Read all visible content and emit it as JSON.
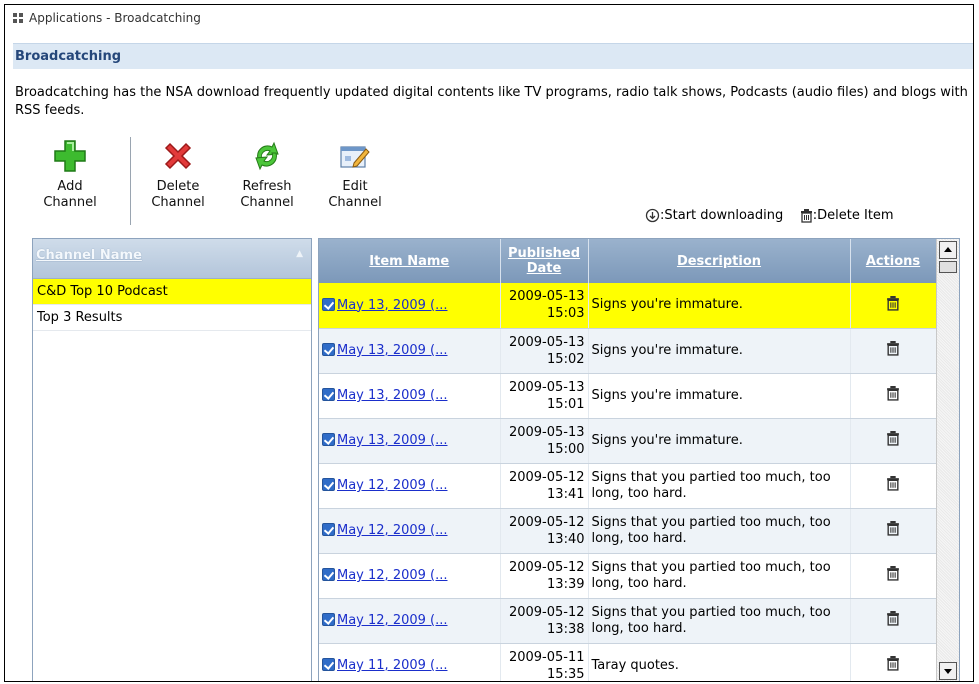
{
  "breadcrumb": {
    "text": "Applications - Broadcatching"
  },
  "section": {
    "title": "Broadcatching"
  },
  "intro": {
    "text": "Broadcatching has the NSA download frequently updated digital contents like TV programs, radio talk shows, Podcasts (audio files) and blogs with RSS feeds."
  },
  "toolbar": {
    "add_line1": "Add",
    "add_line2": "Channel",
    "delete_line1": "Delete",
    "delete_line2": "Channel",
    "refresh_line1": "Refresh",
    "refresh_line2": "Channel",
    "edit_line1": "Edit",
    "edit_line2": "Channel"
  },
  "legend": {
    "start_downloading": ":Start downloading",
    "delete_item": ":Delete Item"
  },
  "channels": {
    "header": "Channel Name",
    "items": [
      {
        "name": "C&D Top 10 Podcast",
        "selected": true
      },
      {
        "name": "Top 3 Results",
        "selected": false
      }
    ]
  },
  "items_table": {
    "headers": {
      "item_name": "Item Name",
      "published_line1": "Published",
      "published_line2": "Date",
      "description": "Description",
      "actions": "Actions"
    },
    "rows": [
      {
        "name": "May 13, 2009 (...",
        "date": "2009-05-13",
        "time": "15:03",
        "desc": "Signs you're immature."
      },
      {
        "name": "May 13, 2009 (...",
        "date": "2009-05-13",
        "time": "15:02",
        "desc": "Signs you're immature."
      },
      {
        "name": "May 13, 2009 (...",
        "date": "2009-05-13",
        "time": "15:01",
        "desc": "Signs you're immature."
      },
      {
        "name": "May 13, 2009 (...",
        "date": "2009-05-13",
        "time": "15:00",
        "desc": "Signs you're immature."
      },
      {
        "name": "May 12, 2009 (...",
        "date": "2009-05-12",
        "time": "13:41",
        "desc": "Signs that you partied too much, too long, too hard."
      },
      {
        "name": "May 12, 2009 (...",
        "date": "2009-05-12",
        "time": "13:40",
        "desc": "Signs that you partied too much, too long, too hard."
      },
      {
        "name": "May 12, 2009 (...",
        "date": "2009-05-12",
        "time": "13:39",
        "desc": "Signs that you partied too much, too long, too hard."
      },
      {
        "name": "May 12, 2009 (...",
        "date": "2009-05-12",
        "time": "13:38",
        "desc": "Signs that you partied too much, too long, too hard."
      },
      {
        "name": "May 11, 2009 (...",
        "date": "2009-05-11",
        "time": "15:35",
        "desc": "Taray quotes."
      }
    ]
  },
  "colors": {
    "highlight": "#ffff00",
    "header": "#7c98b9",
    "link": "#1a2ecb"
  }
}
